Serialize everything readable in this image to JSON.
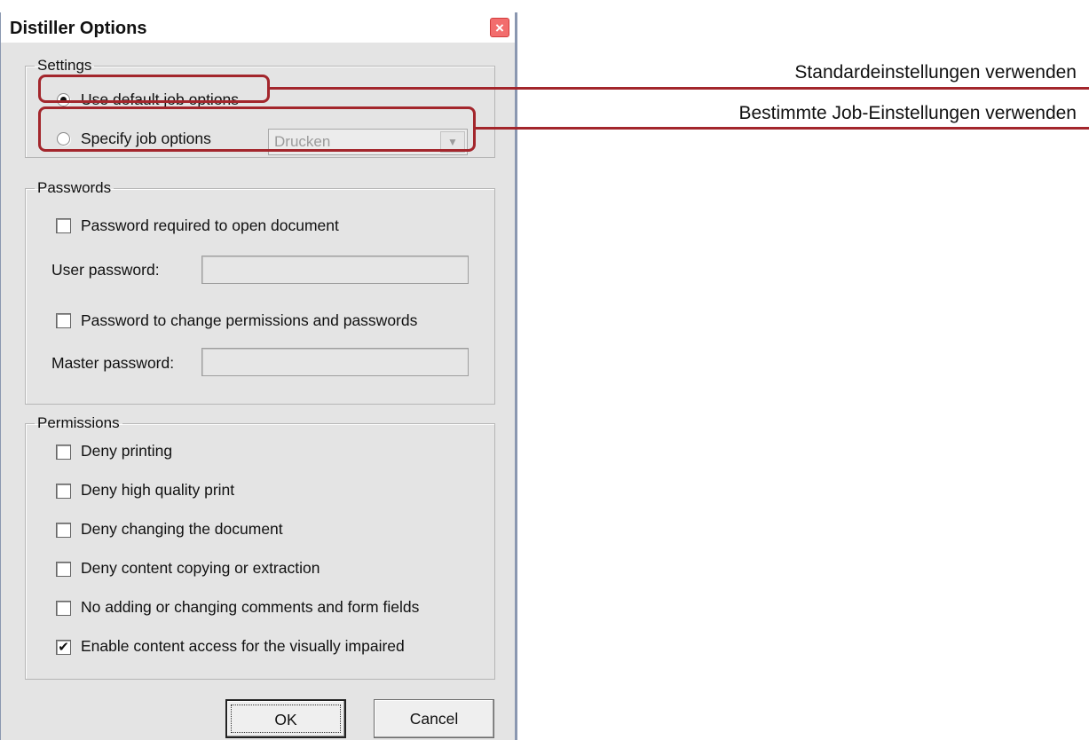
{
  "dialog": {
    "title": "Distiller Options",
    "close_glyph": "×"
  },
  "settings": {
    "legend": "Settings",
    "use_default_label": "Use default job options",
    "use_default_selected": true,
    "specify_label": "Specify job options",
    "specify_selected": false,
    "job_options_value": "Drucken",
    "combo_arrow_icon": "▼"
  },
  "passwords": {
    "legend": "Passwords",
    "require_open_label": "Password required to open document",
    "require_open_checked": false,
    "user_password_label": "User password:",
    "user_password_value": "",
    "change_perm_label": "Password to change permissions and passwords",
    "change_perm_checked": false,
    "master_password_label": "Master password:",
    "master_password_value": ""
  },
  "permissions": {
    "legend": "Permissions",
    "items": [
      {
        "label": "Deny printing",
        "mark": ""
      },
      {
        "label": "Deny high quality print",
        "mark": ""
      },
      {
        "label": "Deny changing the document",
        "mark": ""
      },
      {
        "label": "Deny content copying or extraction",
        "mark": ""
      },
      {
        "label": "No adding or changing comments and form fields",
        "mark": ""
      },
      {
        "label": "Enable content access for the visually impaired",
        "mark": "✔"
      }
    ]
  },
  "buttons": {
    "ok": "OK",
    "cancel": "Cancel"
  },
  "annotations": {
    "default_note": "Standardeinstellungen verwenden",
    "specify_note": "Bestimmte Job-Einstellungen verwenden",
    "highlight_color": "#a3262c"
  }
}
